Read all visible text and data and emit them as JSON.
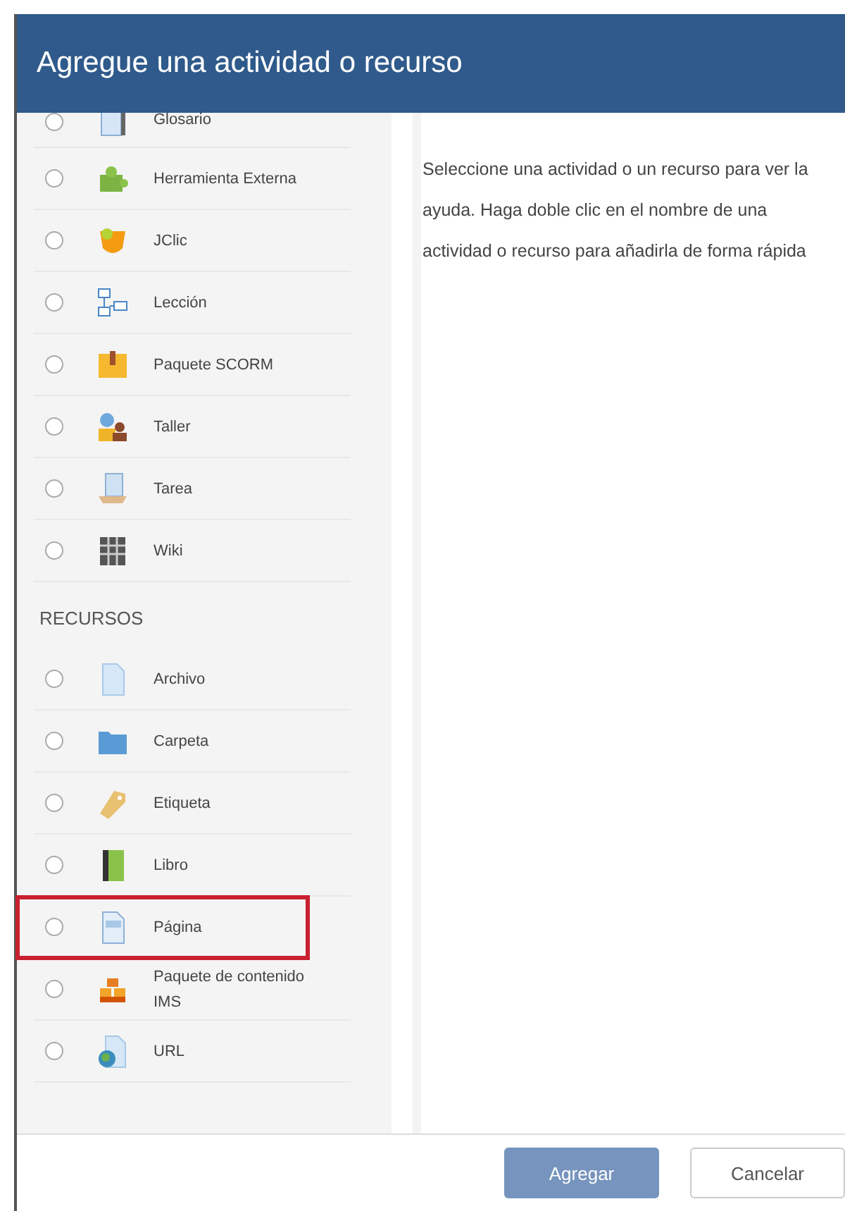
{
  "dialog": {
    "title": "Agregue una actividad o recurso"
  },
  "activities": [
    {
      "label": "Glosario",
      "selected": false
    },
    {
      "label": "Herramienta Externa",
      "selected": false
    },
    {
      "label": "JClic",
      "selected": false
    },
    {
      "label": "Lección",
      "selected": false
    },
    {
      "label": "Paquete SCORM",
      "selected": false
    },
    {
      "label": "Taller",
      "selected": false
    },
    {
      "label": "Tarea",
      "selected": false
    },
    {
      "label": "Wiki",
      "selected": false
    }
  ],
  "resources_heading": "RECURSOS",
  "resources": [
    {
      "label": "Archivo",
      "selected": false,
      "highlighted": false
    },
    {
      "label": "Carpeta",
      "selected": false,
      "highlighted": false
    },
    {
      "label": "Etiqueta",
      "selected": false,
      "highlighted": false
    },
    {
      "label": "Libro",
      "selected": false,
      "highlighted": false
    },
    {
      "label": "Página",
      "selected": false,
      "highlighted": true
    },
    {
      "label": "Paquete de contenido IMS",
      "selected": false,
      "highlighted": false
    },
    {
      "label": "URL",
      "selected": false,
      "highlighted": false
    }
  ],
  "help_text": "Seleccione una actividad o un recurso para ver la ayuda. Haga doble clic en el nombre de una actividad o recurso para añadirla de forma rápida",
  "buttons": [
    {
      "label": "Agregar",
      "kind": "primary"
    },
    {
      "label": "Cancelar",
      "kind": "secondary"
    }
  ]
}
